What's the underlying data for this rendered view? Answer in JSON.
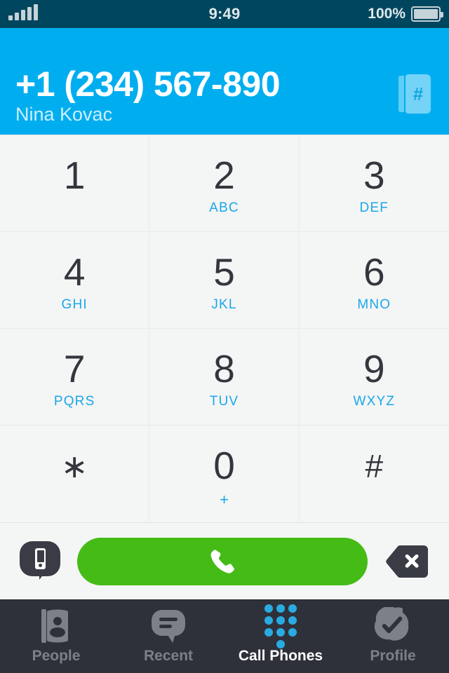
{
  "status_bar": {
    "time": "9:49",
    "battery_percent": "100%",
    "signal_icon": "signal-bars-icon",
    "battery_icon": "battery-full-icon",
    "signal_bars": 5
  },
  "header": {
    "phone_number": "+1 (234) 567-890",
    "contact_name": "Nina Kovac",
    "addressbook_icon": "addressbook-hash-icon",
    "addressbook_glyph": "#",
    "background_color": "#00aeef"
  },
  "keypad": {
    "keys": [
      {
        "digit": "1",
        "letters": ""
      },
      {
        "digit": "2",
        "letters": "ABC"
      },
      {
        "digit": "3",
        "letters": "DEF"
      },
      {
        "digit": "4",
        "letters": "GHI"
      },
      {
        "digit": "5",
        "letters": "JKL"
      },
      {
        "digit": "6",
        "letters": "MNO"
      },
      {
        "digit": "7",
        "letters": "PQRS"
      },
      {
        "digit": "8",
        "letters": "TUV"
      },
      {
        "digit": "9",
        "letters": "WXYZ"
      },
      {
        "digit": "∗",
        "letters": ""
      },
      {
        "digit": "0",
        "letters": "+"
      },
      {
        "digit": "#",
        "letters": ""
      }
    ]
  },
  "action_bar": {
    "sms_icon": "sms-mobile-bubble-icon",
    "call_icon": "phone-handset-icon",
    "delete_icon": "backspace-delete-icon",
    "call_button_color": "#45bb15"
  },
  "tab_bar": {
    "tabs": [
      {
        "label": "People",
        "icon": "contact-card-icon",
        "active": false
      },
      {
        "label": "Recent",
        "icon": "chat-bubble-icon",
        "active": false
      },
      {
        "label": "Call Phones",
        "icon": "dialpad-dots-icon",
        "active": true
      },
      {
        "label": "Profile",
        "icon": "profile-check-icon",
        "active": false
      }
    ],
    "active_color": "#29abe2",
    "inactive_color": "#7d8089",
    "background_color": "#2e313a"
  }
}
